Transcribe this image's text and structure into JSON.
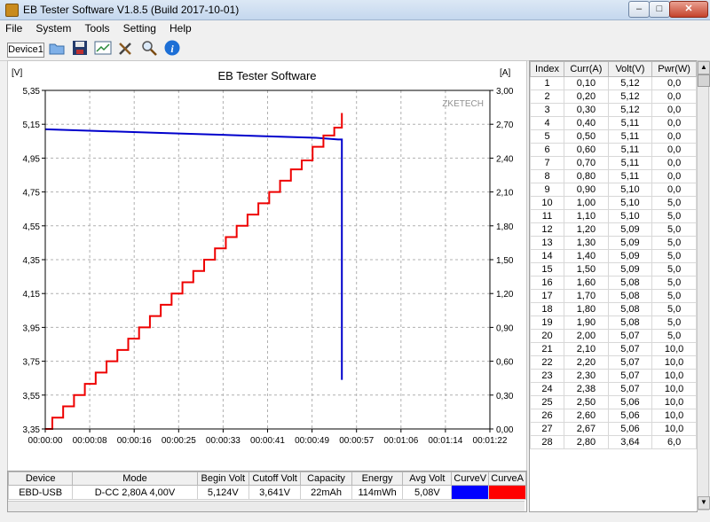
{
  "window": {
    "title": "EB Tester Software V1.8.5 (Build 2017-10-01)"
  },
  "menu": [
    "File",
    "System",
    "Tools",
    "Setting",
    "Help"
  ],
  "toolbar": {
    "device_tab": "Device1"
  },
  "chart": {
    "title": "EB Tester Software",
    "watermark": "ZKETECH",
    "left_unit": "[V]",
    "right_unit": "[A]"
  },
  "chart_data": {
    "type": "line",
    "title": "EB Tester Software",
    "xlim": [
      0,
      82
    ],
    "x_ticks": [
      "00:00:00",
      "00:00:08",
      "00:00:16",
      "00:00:25",
      "00:00:33",
      "00:00:41",
      "00:00:49",
      "00:00:57",
      "00:01:06",
      "00:01:14",
      "00:01:22"
    ],
    "y_left": {
      "label": "[V]",
      "ylim": [
        3.35,
        5.35
      ],
      "ticks": [
        "3,35",
        "3,55",
        "3,75",
        "3,95",
        "4,15",
        "4,35",
        "4,55",
        "4,75",
        "4,95",
        "5,15",
        "5,35"
      ]
    },
    "y_right": {
      "label": "[A]",
      "ylim": [
        0,
        3.0
      ],
      "ticks": [
        "0,00",
        "0,30",
        "0,60",
        "0,90",
        "1,20",
        "1,50",
        "1,80",
        "2,10",
        "2,40",
        "2,70",
        "3,00"
      ]
    },
    "grid": true,
    "series": [
      {
        "axis": "left",
        "color": "#0000cc",
        "points": [
          [
            0,
            5.12
          ],
          [
            10,
            5.11
          ],
          [
            20,
            5.1
          ],
          [
            30,
            5.09
          ],
          [
            40,
            5.08
          ],
          [
            50,
            5.07
          ],
          [
            54,
            5.06
          ],
          [
            54.7,
            5.06
          ],
          [
            54.7,
            3.64
          ]
        ]
      },
      {
        "axis": "right",
        "color": "#ee0000",
        "steps": [
          [
            0,
            0
          ],
          [
            1.3,
            0.1
          ],
          [
            3.3,
            0.2
          ],
          [
            5.3,
            0.3
          ],
          [
            7.3,
            0.4
          ],
          [
            9.3,
            0.5
          ],
          [
            11.3,
            0.6
          ],
          [
            13.3,
            0.7
          ],
          [
            15.3,
            0.8
          ],
          [
            17.3,
            0.9
          ],
          [
            19.3,
            1.0
          ],
          [
            21.3,
            1.1
          ],
          [
            23.3,
            1.2
          ],
          [
            25.3,
            1.3
          ],
          [
            27.3,
            1.4
          ],
          [
            29.3,
            1.5
          ],
          [
            31.3,
            1.6
          ],
          [
            33.3,
            1.7
          ],
          [
            35.3,
            1.8
          ],
          [
            37.3,
            1.9
          ],
          [
            39.3,
            2.0
          ],
          [
            41.3,
            2.1
          ],
          [
            43.3,
            2.2
          ],
          [
            45.3,
            2.3
          ],
          [
            47.3,
            2.38
          ],
          [
            49.3,
            2.5
          ],
          [
            51.3,
            2.6
          ],
          [
            53.3,
            2.67
          ],
          [
            54.7,
            2.8
          ]
        ]
      }
    ]
  },
  "summary": {
    "headers": [
      "Device",
      "Mode",
      "Begin Volt",
      "Cutoff Volt",
      "Capacity",
      "Energy",
      "Avg Volt",
      "CurveV",
      "CurveA"
    ],
    "row": [
      "EBD-USB",
      "D-CC  2,80A  4,00V",
      "5,124V",
      "3,641V",
      "22mAh",
      "114mWh",
      "5,08V"
    ],
    "curve_colors": [
      "#0000ff",
      "#ff0000"
    ]
  },
  "grid": {
    "headers": [
      "Index",
      "Curr(A)",
      "Volt(V)",
      "Pwr(W)"
    ],
    "rows": [
      [
        "1",
        "0,10",
        "5,12",
        "0,0"
      ],
      [
        "2",
        "0,20",
        "5,12",
        "0,0"
      ],
      [
        "3",
        "0,30",
        "5,12",
        "0,0"
      ],
      [
        "4",
        "0,40",
        "5,11",
        "0,0"
      ],
      [
        "5",
        "0,50",
        "5,11",
        "0,0"
      ],
      [
        "6",
        "0,60",
        "5,11",
        "0,0"
      ],
      [
        "7",
        "0,70",
        "5,11",
        "0,0"
      ],
      [
        "8",
        "0,80",
        "5,11",
        "0,0"
      ],
      [
        "9",
        "0,90",
        "5,10",
        "0,0"
      ],
      [
        "10",
        "1,00",
        "5,10",
        "5,0"
      ],
      [
        "11",
        "1,10",
        "5,10",
        "5,0"
      ],
      [
        "12",
        "1,20",
        "5,09",
        "5,0"
      ],
      [
        "13",
        "1,30",
        "5,09",
        "5,0"
      ],
      [
        "14",
        "1,40",
        "5,09",
        "5,0"
      ],
      [
        "15",
        "1,50",
        "5,09",
        "5,0"
      ],
      [
        "16",
        "1,60",
        "5,08",
        "5,0"
      ],
      [
        "17",
        "1,70",
        "5,08",
        "5,0"
      ],
      [
        "18",
        "1,80",
        "5,08",
        "5,0"
      ],
      [
        "19",
        "1,90",
        "5,08",
        "5,0"
      ],
      [
        "20",
        "2,00",
        "5,07",
        "5,0"
      ],
      [
        "21",
        "2,10",
        "5,07",
        "10,0"
      ],
      [
        "22",
        "2,20",
        "5,07",
        "10,0"
      ],
      [
        "23",
        "2,30",
        "5,07",
        "10,0"
      ],
      [
        "24",
        "2,38",
        "5,07",
        "10,0"
      ],
      [
        "25",
        "2,50",
        "5,06",
        "10,0"
      ],
      [
        "26",
        "2,60",
        "5,06",
        "10,0"
      ],
      [
        "27",
        "2,67",
        "5,06",
        "10,0"
      ],
      [
        "28",
        "2,80",
        "3,64",
        "6,0"
      ]
    ]
  }
}
